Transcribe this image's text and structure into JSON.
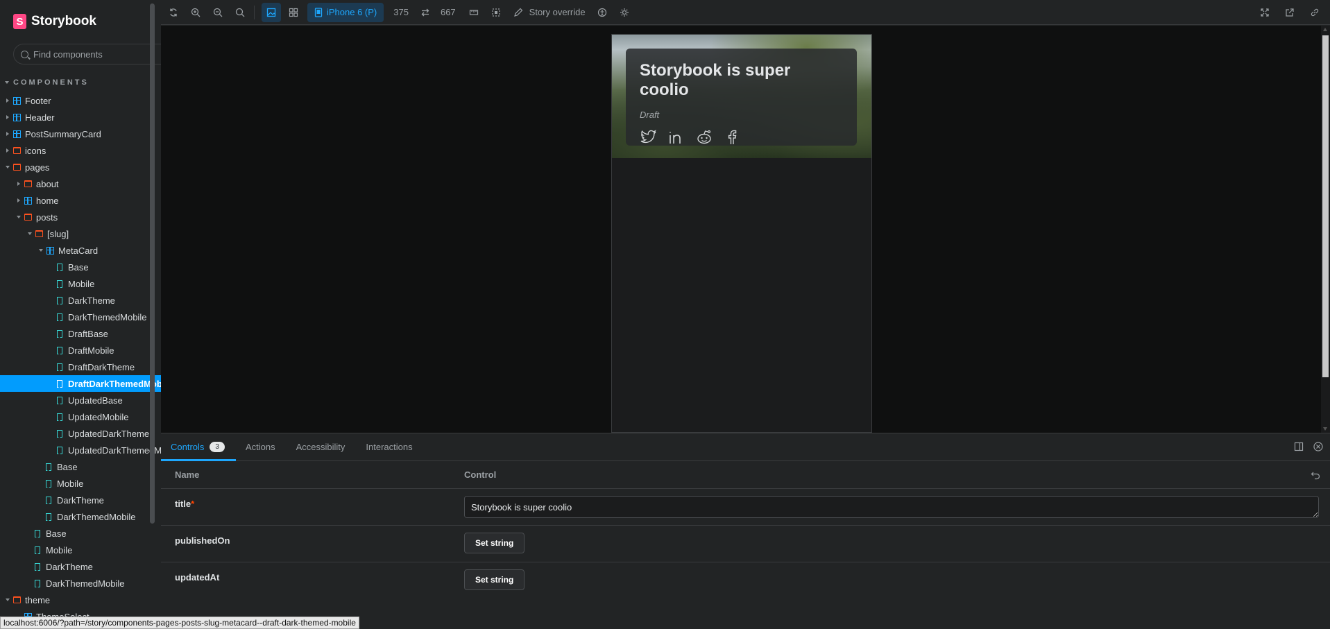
{
  "brand": {
    "name": "Storybook",
    "logo_letter": "S"
  },
  "search": {
    "placeholder": "Find components"
  },
  "sidebar": {
    "section": "COMPONENTS",
    "items": [
      {
        "label": "Footer",
        "type": "component"
      },
      {
        "label": "Header",
        "type": "component"
      },
      {
        "label": "PostSummaryCard",
        "type": "component"
      },
      {
        "label": "icons",
        "type": "folder"
      },
      {
        "label": "pages",
        "type": "folder"
      },
      {
        "label": "about",
        "type": "folder"
      },
      {
        "label": "home",
        "type": "component"
      },
      {
        "label": "posts",
        "type": "folder"
      },
      {
        "label": "[slug]",
        "type": "folder"
      },
      {
        "label": "MetaCard",
        "type": "component"
      },
      {
        "label": "Base",
        "type": "story"
      },
      {
        "label": "Mobile",
        "type": "story"
      },
      {
        "label": "DarkTheme",
        "type": "story"
      },
      {
        "label": "DarkThemedMobile",
        "type": "story"
      },
      {
        "label": "DraftBase",
        "type": "story"
      },
      {
        "label": "DraftMobile",
        "type": "story"
      },
      {
        "label": "DraftDarkTheme",
        "type": "story"
      },
      {
        "label": "DraftDarkThemedMobile",
        "type": "story",
        "selected": true
      },
      {
        "label": "UpdatedBase",
        "type": "story"
      },
      {
        "label": "UpdatedMobile",
        "type": "story"
      },
      {
        "label": "UpdatedDarkTheme",
        "type": "story"
      },
      {
        "label": "UpdatedDarkThemedMobile",
        "type": "story"
      },
      {
        "label": "Base",
        "type": "story"
      },
      {
        "label": "Mobile",
        "type": "story"
      },
      {
        "label": "DarkTheme",
        "type": "story"
      },
      {
        "label": "DarkThemedMobile",
        "type": "story"
      },
      {
        "label": "Base",
        "type": "story"
      },
      {
        "label": "Mobile",
        "type": "story"
      },
      {
        "label": "DarkTheme",
        "type": "story"
      },
      {
        "label": "DarkThemedMobile",
        "type": "story"
      },
      {
        "label": "theme",
        "type": "folder"
      },
      {
        "label": "ThemeSelect",
        "type": "component"
      }
    ]
  },
  "toolbar": {
    "viewport_label": "iPhone 6 (P)",
    "width": "375",
    "height": "667",
    "story_override": "Story override"
  },
  "preview": {
    "card_title": "Storybook is super coolio",
    "card_status": "Draft",
    "socials": [
      "twitter-icon",
      "linkedin-icon",
      "reddit-icon",
      "facebook-icon"
    ]
  },
  "panel": {
    "tabs": [
      {
        "label": "Controls",
        "badge": "3"
      },
      {
        "label": "Actions"
      },
      {
        "label": "Accessibility"
      },
      {
        "label": "Interactions"
      }
    ],
    "head_name": "Name",
    "head_control": "Control",
    "rows": [
      {
        "name": "title",
        "required": "*",
        "value": "Storybook is super coolio"
      },
      {
        "name": "publishedOn",
        "button": "Set string"
      },
      {
        "name": "updatedAt",
        "button": "Set string"
      }
    ]
  },
  "status_url": "localhost:6006/?path=/story/components-pages-posts-slug-metacard--draft-dark-themed-mobile",
  "colors": {
    "accent": "#029cfd",
    "brand": "#ff4785",
    "folder": "#fc521f",
    "story": "#37d5d3"
  }
}
